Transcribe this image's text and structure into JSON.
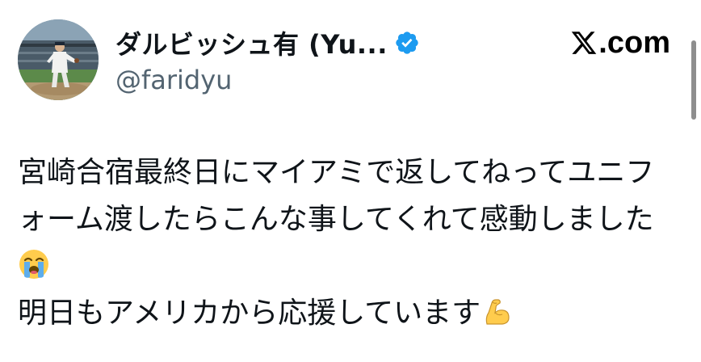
{
  "header": {
    "display_name": "ダルビッシュ有 (Yu...",
    "handle": "@faridyu",
    "source_logo_text": ".com",
    "verified": true
  },
  "tweet": {
    "line_1": "宮崎合宿最終日にマイアミで返してねってユニフ",
    "line_2": "ォーム渡したらこんな事してくれて感動しました",
    "line_4": "明日もアメリカから応援しています"
  },
  "icons": {
    "verified": "verified-badge-icon",
    "logo": "x-logo-icon",
    "emoji_1": "loudly-crying-face-emoji",
    "emoji_2": "flexed-biceps-emoji"
  },
  "colors": {
    "text": "#0f1419",
    "secondary_text": "#536471",
    "verified_blue": "#1d9bf0",
    "logo_black": "#000000"
  }
}
